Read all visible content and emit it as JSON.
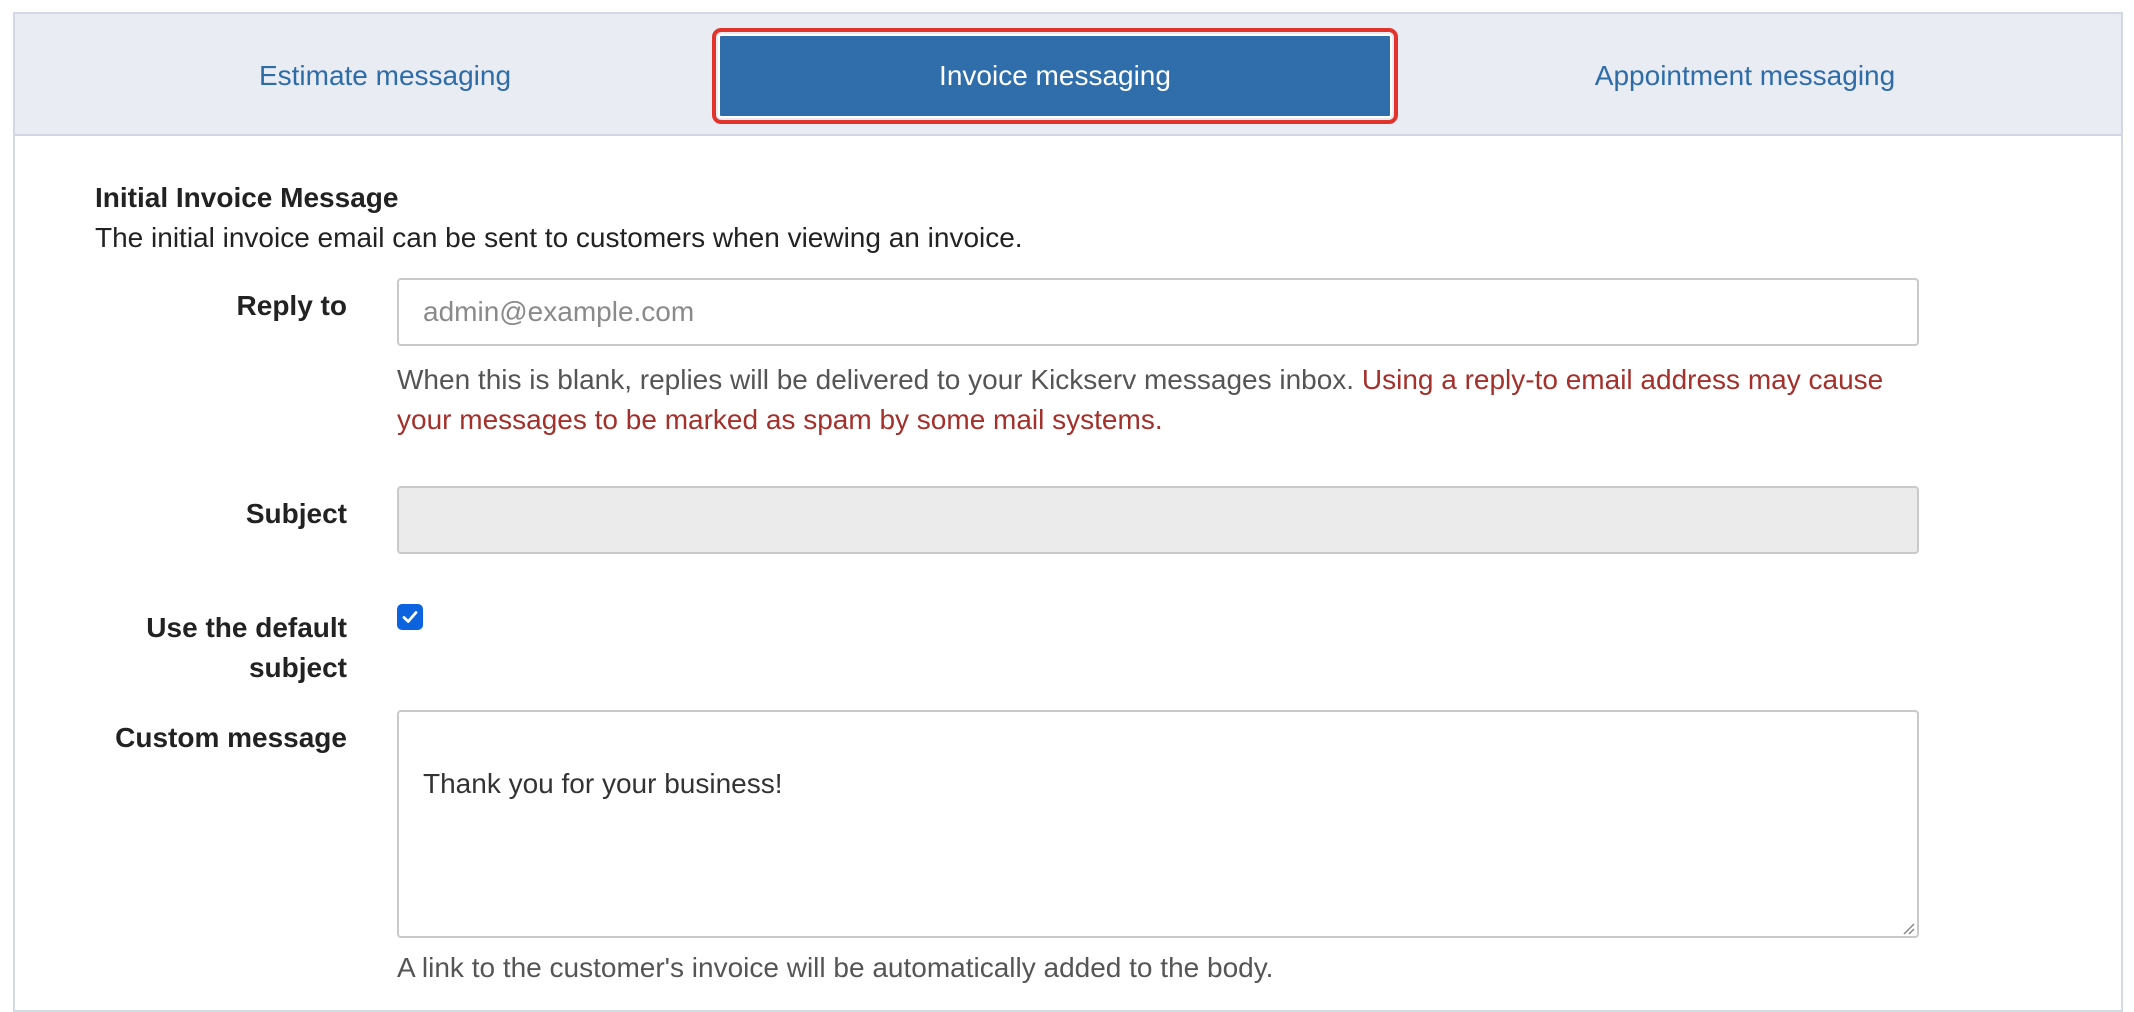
{
  "tabs": [
    {
      "label": "Estimate messaging"
    },
    {
      "label": "Invoice messaging"
    },
    {
      "label": "Appointment messaging"
    }
  ],
  "section": {
    "title": "Initial Invoice Message",
    "description": "The initial invoice email can be sent to customers when viewing an invoice."
  },
  "reply_to": {
    "label": "Reply to",
    "placeholder": "admin@example.com",
    "value": "",
    "help_normal": "When this is blank, replies will be delivered to your Kickserv messages inbox. ",
    "help_warning": "Using a reply-to email address may cause your messages to be marked as spam by some mail systems."
  },
  "subject": {
    "label": "Subject",
    "value": "",
    "disabled": true
  },
  "default_subject": {
    "label": "Use the default subject",
    "checked": true
  },
  "custom_message": {
    "label": "Custom message",
    "value": "Thank you for your business!",
    "help": "A link to the customer's invoice will be automatically added to the body."
  },
  "colors": {
    "active_tab": "#2f6dab",
    "tab_text": "#2e6ca8",
    "highlight": "#e0342c",
    "warning": "#a3302b",
    "checkbox": "#0b63e0"
  },
  "icons": {
    "checkbox": "checkmark-icon",
    "resize": "resize-grip-icon"
  }
}
